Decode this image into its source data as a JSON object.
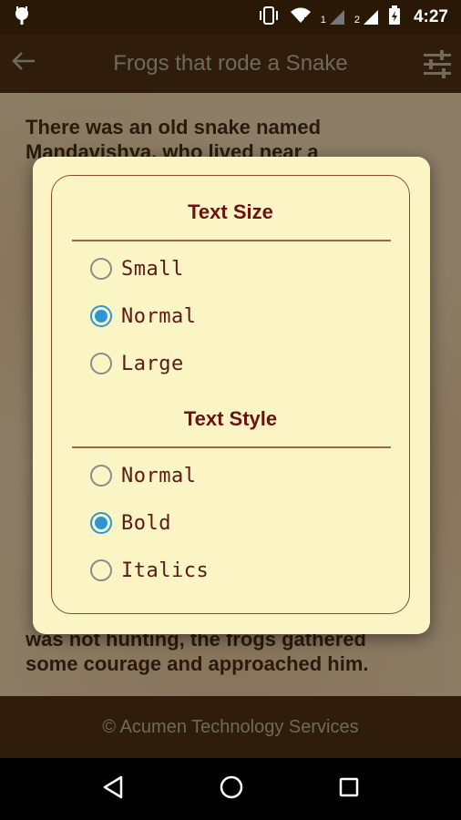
{
  "status_bar": {
    "sim1_label": "1",
    "sim2_label": "2",
    "time": "4:27"
  },
  "app_bar": {
    "title": "Frogs that rode a Snake",
    "back_icon": "back-arrow-icon",
    "settings_icon": "tune-sliders-icon"
  },
  "story": {
    "paragraph1_line1": "There was an old snake named",
    "paragraph1_line2": "Mandavishya, who lived near a",
    "paragraph_end_line1": "was not hunting, the frogs gathered",
    "paragraph_end_line2": "some courage and approached him."
  },
  "dialog": {
    "text_size": {
      "title": "Text Size",
      "options": [
        "Small",
        "Normal",
        "Large"
      ],
      "selected": "Normal"
    },
    "text_style": {
      "title": "Text Style",
      "options": [
        "Normal",
        "Bold",
        "Italics"
      ],
      "selected": "Bold"
    }
  },
  "footer": {
    "text": "© Acumen Technology Services"
  },
  "nav_bar": {
    "icons": [
      "back-triangle-icon",
      "home-circle-icon",
      "recents-square-icon"
    ]
  },
  "colors": {
    "accent": "#2b96d6",
    "dialog_bg": "#fbf5c6",
    "title_red": "#6b1212",
    "bar_brown": "#2f1c0a"
  }
}
